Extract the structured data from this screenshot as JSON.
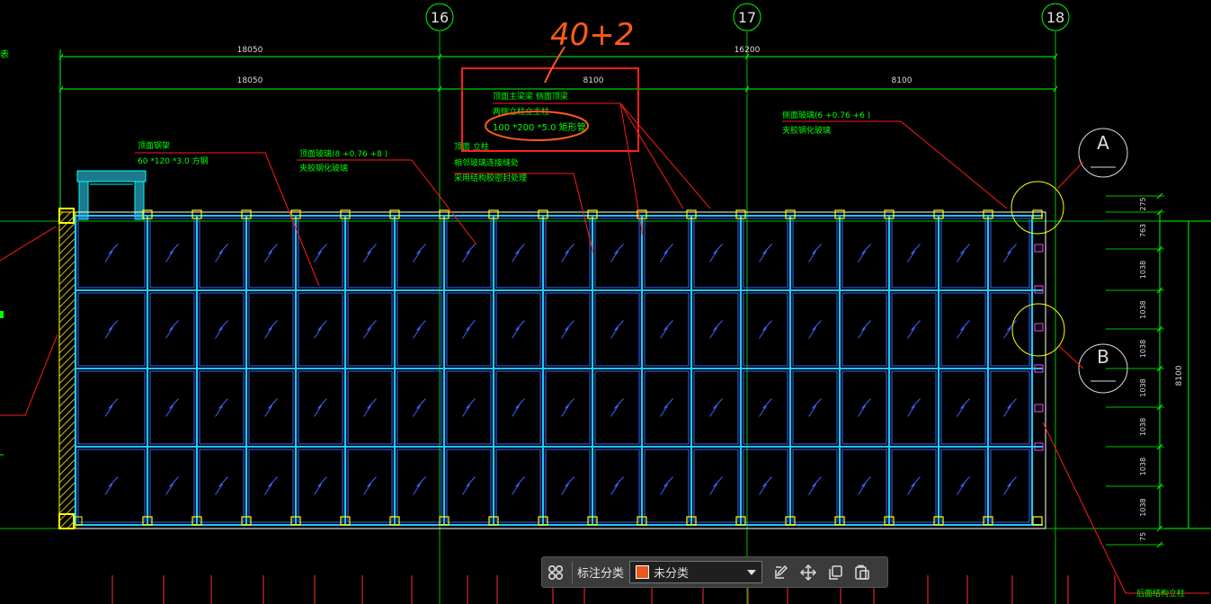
{
  "grid_axes": {
    "a16": "16",
    "a17": "17",
    "a18": "18",
    "rowA": "A",
    "rowB": "B"
  },
  "dimensions": {
    "top_total_left": "18050",
    "top_total_right": "16200",
    "top_left": "18050",
    "top_mid": "8100",
    "top_right": "8100",
    "right_total": "8100",
    "right_segments": [
      "275",
      "763",
      "1038",
      "1038",
      "1038",
      "1038",
      "1038",
      "1038",
      "1038",
      "75"
    ]
  },
  "handwritten_note": "40+2",
  "annotations": {
    "roof_frame": [
      "顶面钢架",
      "60 *120 *3.0 方钢"
    ],
    "roof_glass": [
      "顶面玻璃(8 +0.76 +8 )",
      "夹胶钢化玻璃"
    ],
    "roof_joint": [
      "顶面   立柱",
      "相邻玻璃连接缝处",
      "采用结构胶密封处理"
    ],
    "main_beam": [
      "顶面主梁梁  侧面顶梁",
      "两侧立柱立主柱",
      "100 *200 *5.0 矩形管"
    ],
    "side_glass": [
      "侧面玻璃(6 +0.76 +6 )",
      "夹胶钢化玻璃"
    ],
    "rear_column": "后面结构立柱"
  },
  "toolbar": {
    "layout_icon": "grid-icon",
    "category_label": "标注分类",
    "category_value": "未分类",
    "category_color": "#e8581f",
    "tools": [
      "edit-icon",
      "move-icon",
      "copy-icon",
      "paste-icon"
    ]
  },
  "colors": {
    "background": "#000000",
    "axis": "#00ff00",
    "glass_frame": "#00ffff",
    "leader": "#ff0000",
    "highlight": "#ff2020",
    "marker": "#ffff00"
  }
}
